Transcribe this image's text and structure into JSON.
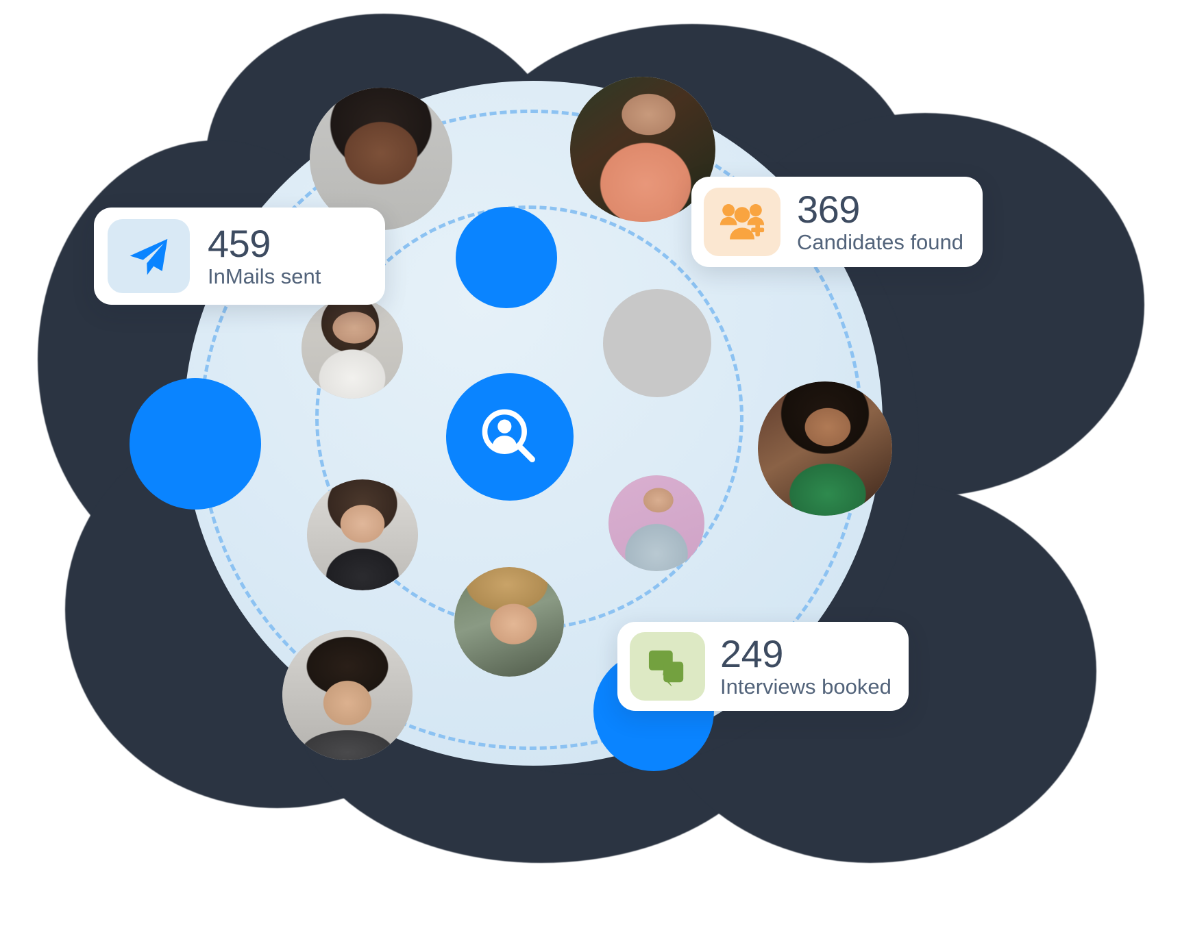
{
  "illustration": {
    "title": "Recruiting search network illustration",
    "background_color": "#2b3442",
    "sphere_color": "#dcebf6",
    "accent_blue": "#0a84ff",
    "orbit_dash_color": "#8cc2f2"
  },
  "center": {
    "icon": "person-search-icon",
    "badge_color": "#0a84ff"
  },
  "decorative_circles": [
    {
      "name": "blue-circle-top",
      "color": "#0a84ff"
    },
    {
      "name": "blue-circle-left",
      "color": "#0a84ff"
    },
    {
      "name": "blue-circle-bottom",
      "color": "#0a84ff"
    }
  ],
  "avatars": [
    {
      "name": "avatar-1",
      "alt": "Woman with short dark hair"
    },
    {
      "name": "avatar-2",
      "alt": "Woman in peach shirt with foliage background"
    },
    {
      "name": "avatar-3",
      "alt": "Woman in white blouse"
    },
    {
      "name": "avatar-4",
      "alt": "Man with glasses in dark suit"
    },
    {
      "name": "avatar-5",
      "alt": "Woman in green top with hoop earrings"
    },
    {
      "name": "avatar-6",
      "alt": "Woman with glasses smiling"
    },
    {
      "name": "avatar-7",
      "alt": "Woman in light blazer on pink background"
    },
    {
      "name": "avatar-8",
      "alt": "Man with wavy blonde hair outdoors"
    },
    {
      "name": "avatar-9",
      "alt": "Man wearing a hat with curly hair"
    }
  ],
  "stats": [
    {
      "id": "inmails",
      "value": "459",
      "label": "InMails sent",
      "icon": "paper-plane-icon",
      "icon_color": "#0a84ff",
      "icon_bg": "#d9e9f5"
    },
    {
      "id": "candidates",
      "value": "369",
      "label": "Candidates found",
      "icon": "group-add-icon",
      "icon_color": "#f9a440",
      "icon_bg": "#fbe7d1"
    },
    {
      "id": "interviews",
      "value": "249",
      "label": "Interviews booked",
      "icon": "chat-bubbles-icon",
      "icon_color": "#73a13f",
      "icon_bg": "#dde9c4"
    }
  ]
}
